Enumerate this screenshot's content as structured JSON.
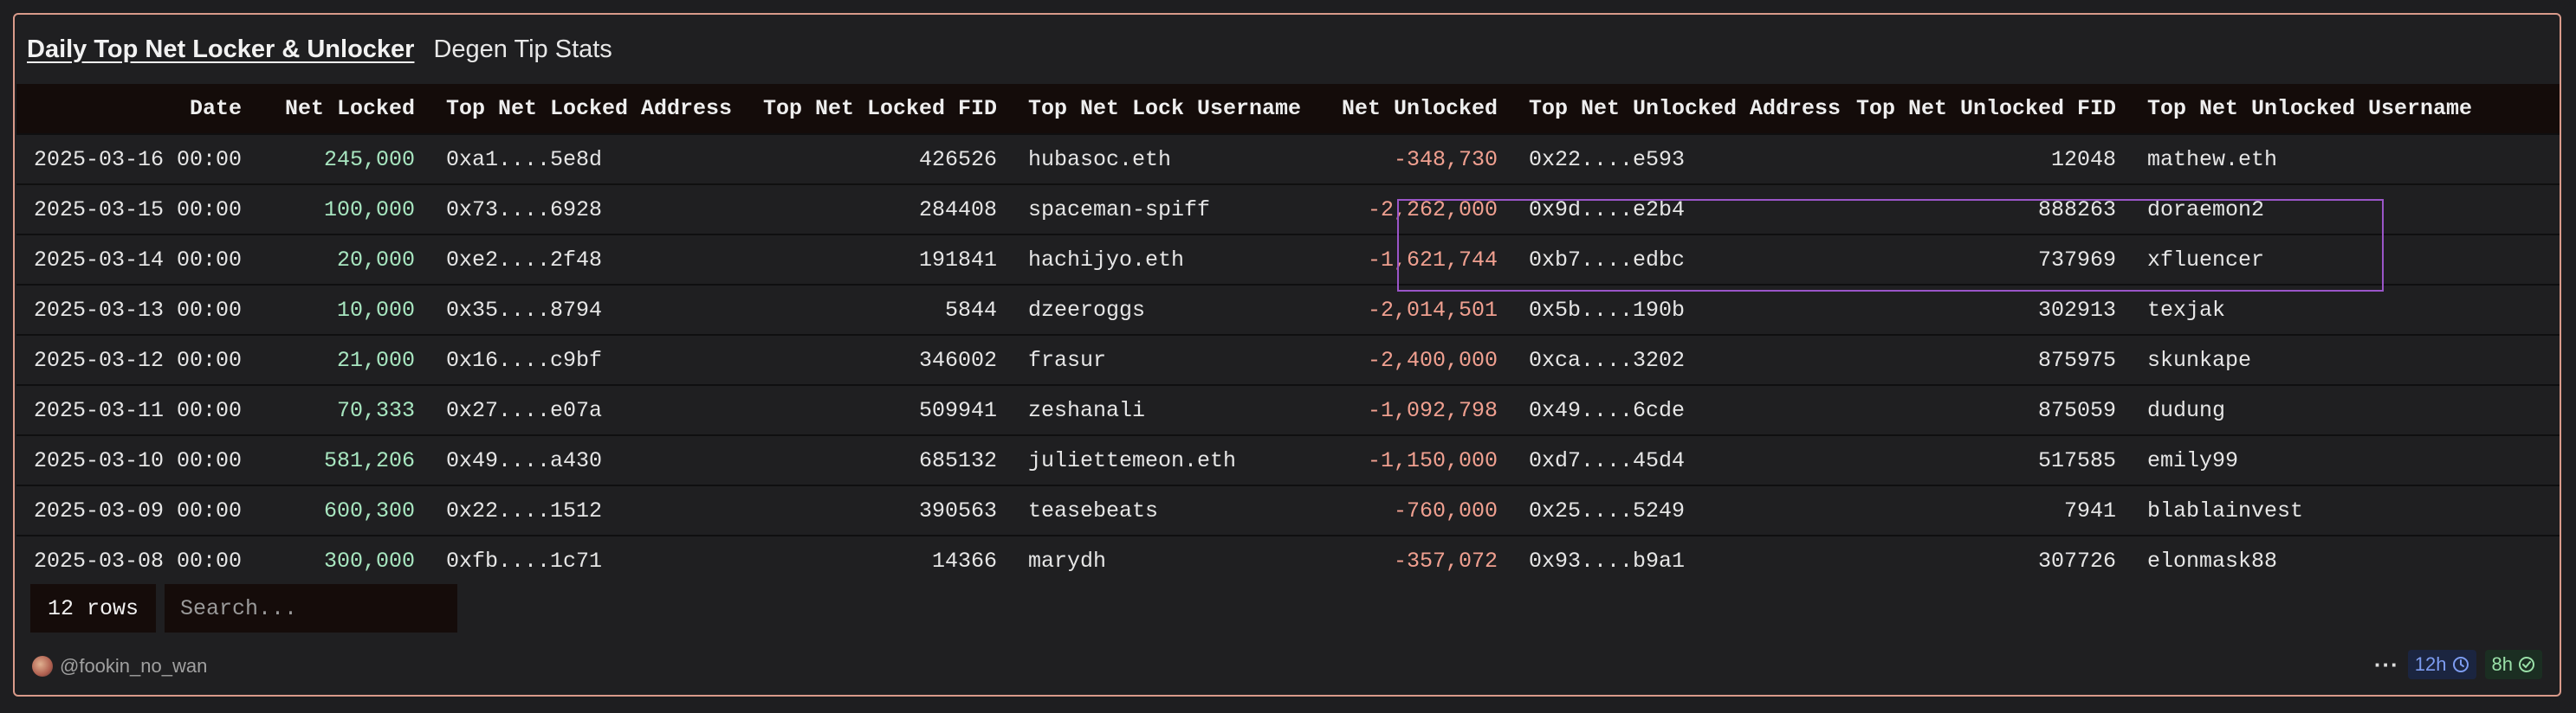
{
  "header": {
    "title": "Daily Top Net Locker & Unlocker",
    "subtitle": "Degen Tip Stats"
  },
  "table": {
    "columns": [
      "Date",
      "Net Locked",
      "Top Net Locked Address",
      "Top Net Locked FID",
      "Top Net Lock Username",
      "Net Unlocked",
      "Top Net Unlocked Address",
      "Top Net Unlocked FID",
      "Top Net Unlocked Username"
    ],
    "rows": [
      [
        "2025-03-16 00:00",
        "245,000",
        "0xa1....5e8d",
        "426526",
        "hubasoc.eth",
        "-348,730",
        "0x22....e593",
        "12048",
        "mathew.eth"
      ],
      [
        "2025-03-15 00:00",
        "100,000",
        "0x73....6928",
        "284408",
        "spaceman-spiff",
        "-2,262,000",
        "0x9d....e2b4",
        "888263",
        "doraemon2"
      ],
      [
        "2025-03-14 00:00",
        "20,000",
        "0xe2....2f48",
        "191841",
        "hachijyo.eth",
        "-1,621,744",
        "0xb7....edbc",
        "737969",
        "xfluencer"
      ],
      [
        "2025-03-13 00:00",
        "10,000",
        "0x35....8794",
        "5844",
        "dzeeroggs",
        "-2,014,501",
        "0x5b....190b",
        "302913",
        "texjak"
      ],
      [
        "2025-03-12 00:00",
        "21,000",
        "0x16....c9bf",
        "346002",
        "frasur",
        "-2,400,000",
        "0xca....3202",
        "875975",
        "skunkape"
      ],
      [
        "2025-03-11 00:00",
        "70,333",
        "0x27....e07a",
        "509941",
        "zeshanali",
        "-1,092,798",
        "0x49....6cde",
        "875059",
        "dudung"
      ],
      [
        "2025-03-10 00:00",
        "581,206",
        "0x49....a430",
        "685132",
        "juliettemeon.eth",
        "-1,150,000",
        "0xd7....45d4",
        "517585",
        "emily99"
      ],
      [
        "2025-03-09 00:00",
        "600,300",
        "0x22....1512",
        "390563",
        "teasebeats",
        "-760,000",
        "0x25....5249",
        "7941",
        "blablainvest"
      ],
      [
        "2025-03-08 00:00",
        "300,000",
        "0xfb....1c71",
        "14366",
        "marydh",
        "-357,072",
        "0x93....b9a1",
        "307726",
        "elonmask88"
      ]
    ]
  },
  "controls": {
    "rows_label": "12 rows",
    "search_placeholder": "Search..."
  },
  "footer": {
    "author": "@fookin_no_wan",
    "more": "···",
    "badge_refresh": "12h",
    "badge_ok": "8h"
  },
  "colors": {
    "positive": "#a8e6c0",
    "negative": "#f0a090",
    "border": "#d99a8a",
    "highlight": "#9a55c8"
  },
  "icons": [
    "avatar",
    "more-icon",
    "clock-icon",
    "check-circle-icon"
  ]
}
